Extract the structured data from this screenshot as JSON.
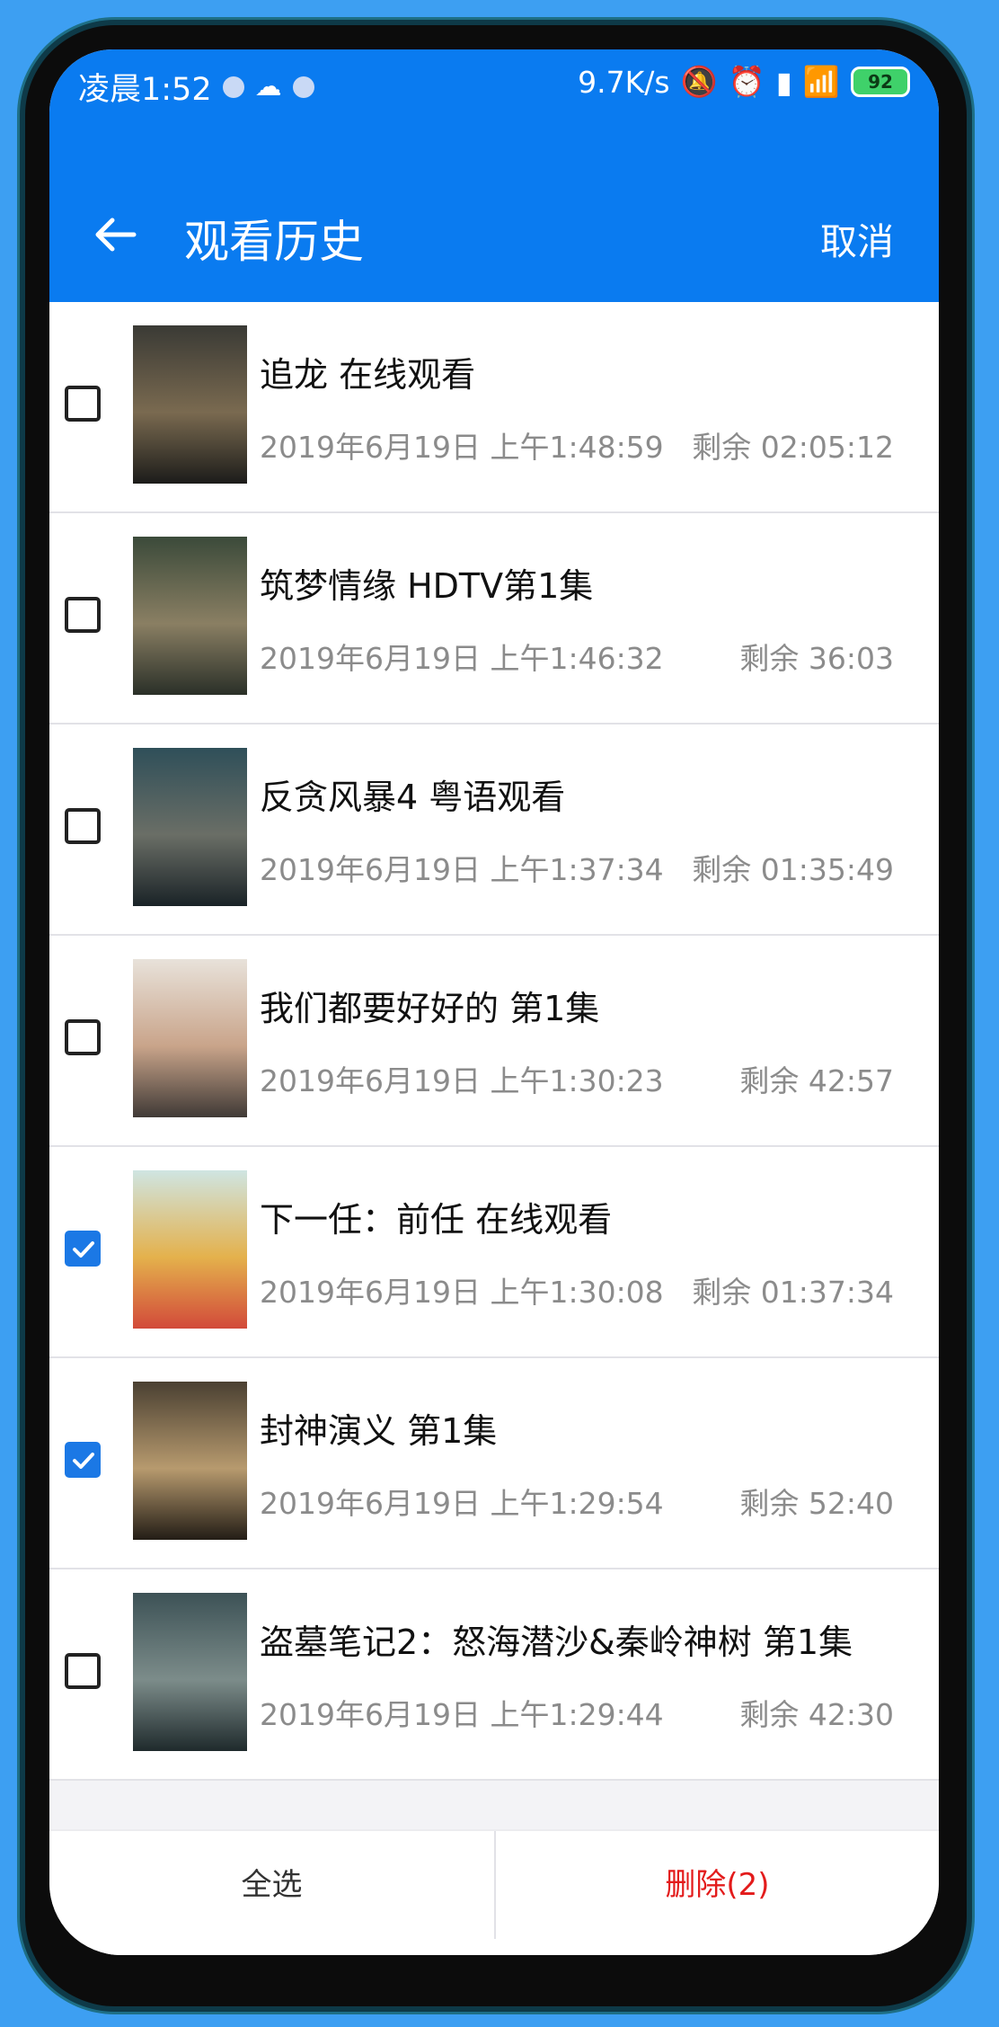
{
  "status_bar": {
    "time": "凌晨1:52",
    "net_speed": "9.7K/s",
    "battery": "92"
  },
  "header": {
    "title": "观看历史",
    "cancel_label": "取消"
  },
  "items": [
    {
      "title": "追龙 在线观看",
      "date": "2019年6月19日 上午1:48:59",
      "remaining": "剩余 02:05:12",
      "checked": false,
      "poster_colors": [
        "#3a3a35",
        "#7a6a50",
        "#1c1c1a"
      ]
    },
    {
      "title": "筑梦情缘 HDTV第1集",
      "date": "2019年6月19日 上午1:46:32",
      "remaining": "剩余 36:03",
      "checked": false,
      "poster_colors": [
        "#3b4a3a",
        "#8a7f63",
        "#2a3028"
      ]
    },
    {
      "title": "反贪风暴4 粤语观看",
      "date": "2019年6月19日 上午1:37:34",
      "remaining": "剩余 01:35:49",
      "checked": false,
      "poster_colors": [
        "#2f4f59",
        "#6a6e66",
        "#1a2327"
      ]
    },
    {
      "title": "我们都要好好的 第1集",
      "date": "2019年6月19日 上午1:30:23",
      "remaining": "剩余 42:57",
      "checked": false,
      "poster_colors": [
        "#e8e2da",
        "#c9a48a",
        "#403a36"
      ]
    },
    {
      "title": "下一任：前任 在线观看",
      "date": "2019年6月19日 上午1:30:08",
      "remaining": "剩余 01:37:34",
      "checked": true,
      "poster_colors": [
        "#cfe5e2",
        "#e4b14c",
        "#d24a3a"
      ]
    },
    {
      "title": "封神演义 第1集",
      "date": "2019年6月19日 上午1:29:54",
      "remaining": "剩余 52:40",
      "checked": true,
      "poster_colors": [
        "#4a4032",
        "#b79a6e",
        "#231d16"
      ]
    },
    {
      "title": "盗墓笔记2：怒海潜沙&秦岭神树 第1集",
      "date": "2019年6月19日 上午1:29:44",
      "remaining": "剩余 42:30",
      "checked": false,
      "poster_colors": [
        "#3d5256",
        "#7c8c8a",
        "#1f2a2c"
      ]
    }
  ],
  "footer": {
    "select_all_label": "全选",
    "delete_label": "删除(2)"
  },
  "colors": {
    "primary": "#0a7bf0",
    "delete": "#e31b1b",
    "check": "#1b78e5"
  }
}
